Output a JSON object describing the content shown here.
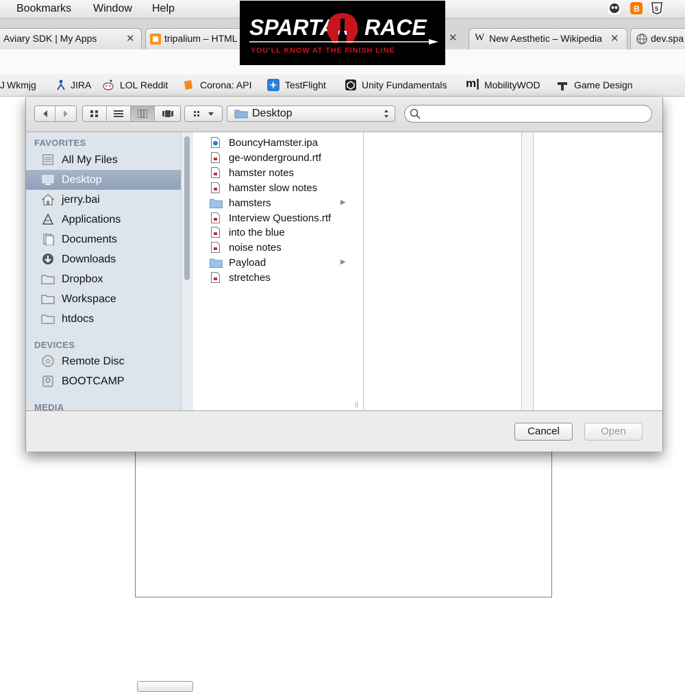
{
  "menubar": {
    "items": [
      "Bookmarks",
      "Window",
      "Help"
    ],
    "status_icons": [
      "alien-icon",
      "blogger-icon",
      "html5-icon"
    ]
  },
  "tabs": [
    {
      "title": "Aviary SDK | My Apps",
      "icon": "aviary-icon"
    },
    {
      "title": "tripalium – HTML",
      "icon": "tripalium-icon"
    },
    {
      "title": "New Aesthetic – Wikipedia",
      "icon": "wikipedia-icon"
    },
    {
      "title": "dev.spa",
      "icon": "globe-icon"
    }
  ],
  "ad": {
    "word1": "SPARTAN",
    "word2": "RACE",
    "tagline": "YOU'LL KNOW AT THE FINISH LINE"
  },
  "bookmarks": [
    {
      "label": "Wkmjg",
      "icon": "wkmjg-icon"
    },
    {
      "label": "JIRA",
      "icon": "jira-icon"
    },
    {
      "label": "LOL Reddit",
      "icon": "reddit-icon"
    },
    {
      "label": "Corona: API",
      "icon": "corona-icon"
    },
    {
      "label": "TestFlight",
      "icon": "testflight-icon"
    },
    {
      "label": "Unity Fundamentals",
      "icon": "unity-icon"
    },
    {
      "label": "MobilityWOD",
      "icon": "mobilitywod-icon"
    },
    {
      "label": "Game Design",
      "icon": "game-design-icon"
    }
  ],
  "dialog": {
    "location": "Desktop",
    "search_placeholder": "",
    "view_mode": "columns",
    "sidebar": {
      "favorites_header": "FAVORITES",
      "favorites": [
        {
          "label": "All My Files",
          "icon": "all-files-icon",
          "selected": false
        },
        {
          "label": "Desktop",
          "icon": "desktop-icon",
          "selected": true
        },
        {
          "label": "jerry.bai",
          "icon": "home-icon",
          "selected": false
        },
        {
          "label": "Applications",
          "icon": "applications-icon",
          "selected": false
        },
        {
          "label": "Documents",
          "icon": "documents-icon",
          "selected": false
        },
        {
          "label": "Downloads",
          "icon": "downloads-icon",
          "selected": false
        },
        {
          "label": "Dropbox",
          "icon": "folder-icon",
          "selected": false
        },
        {
          "label": "Workspace",
          "icon": "folder-icon",
          "selected": false
        },
        {
          "label": "htdocs",
          "icon": "folder-icon",
          "selected": false
        }
      ],
      "devices_header": "DEVICES",
      "devices": [
        {
          "label": "Remote Disc",
          "icon": "disc-icon"
        },
        {
          "label": "BOOTCAMP",
          "icon": "drive-icon"
        }
      ],
      "media_header": "MEDIA"
    },
    "files": [
      {
        "name": "BouncyHamster.ipa",
        "kind": "ipa"
      },
      {
        "name": "ge-wonderground.rtf",
        "kind": "doc"
      },
      {
        "name": "hamster notes",
        "kind": "doc"
      },
      {
        "name": "hamster slow notes",
        "kind": "doc"
      },
      {
        "name": "hamsters",
        "kind": "folder"
      },
      {
        "name": "Interview Questions.rtf",
        "kind": "doc"
      },
      {
        "name": "into the blue",
        "kind": "doc"
      },
      {
        "name": "noise notes",
        "kind": "doc"
      },
      {
        "name": "Payload",
        "kind": "folder"
      },
      {
        "name": "stretches",
        "kind": "doc"
      }
    ],
    "cancel_label": "Cancel",
    "open_label": "Open"
  },
  "colors": {
    "sidebar_bg": "#dce4ec",
    "selection": "#97a8bf",
    "ad_red": "#c4161c"
  }
}
